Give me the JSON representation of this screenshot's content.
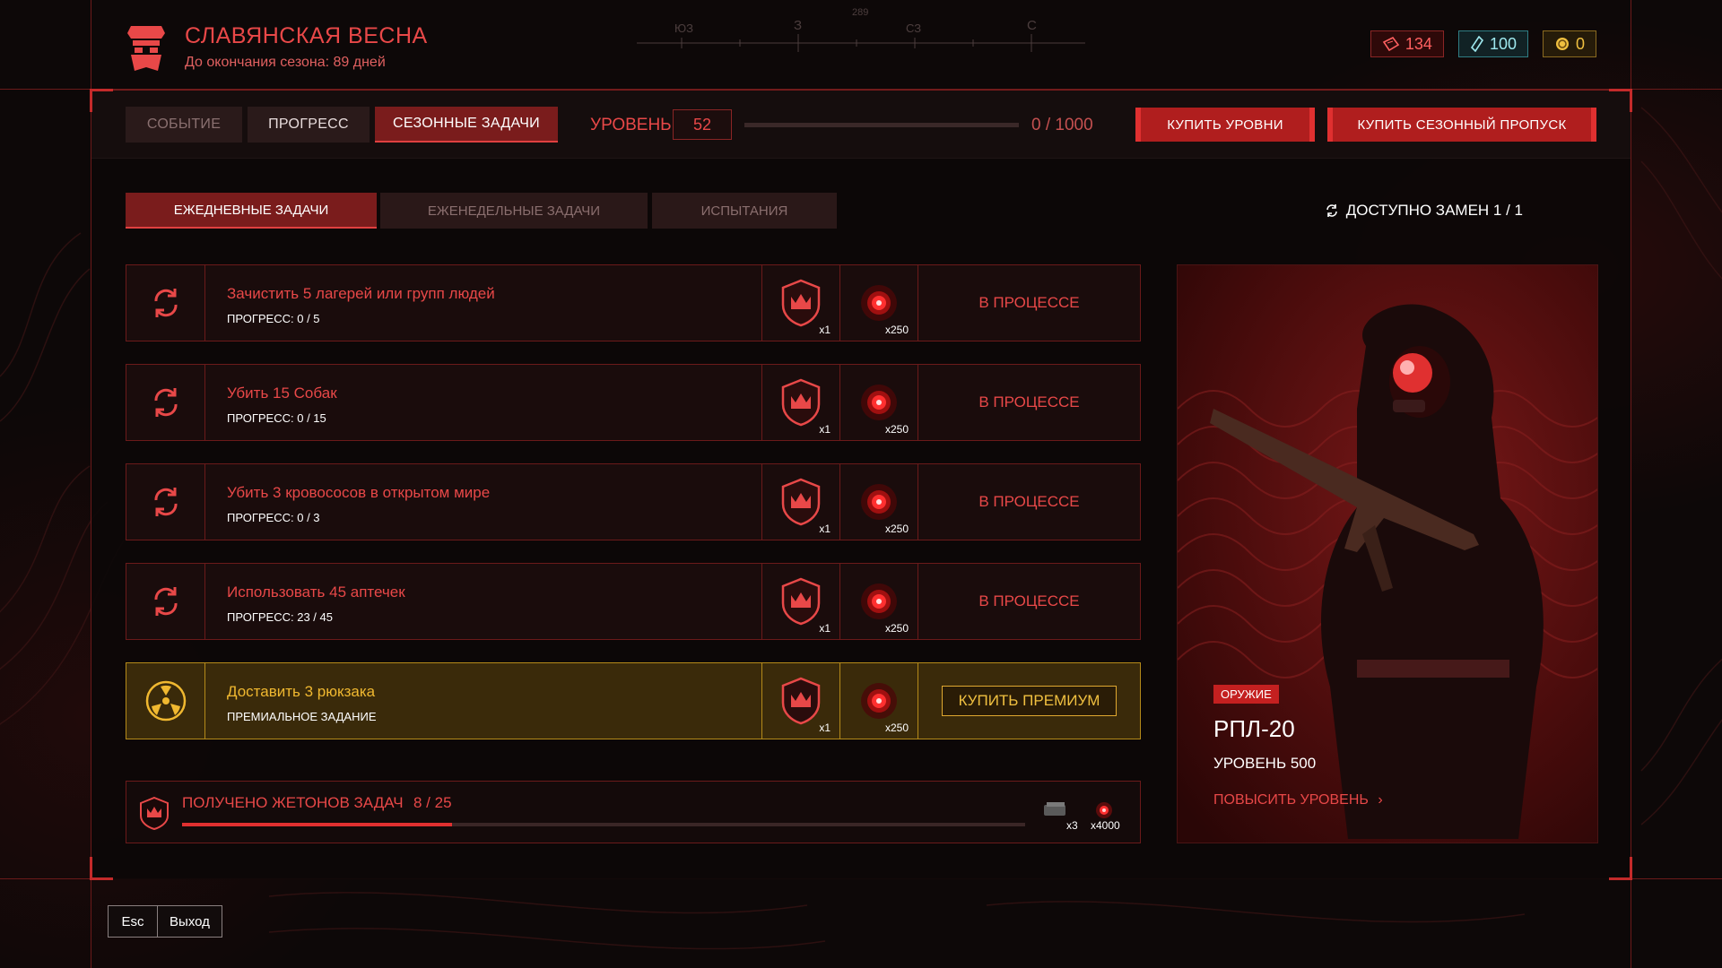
{
  "header": {
    "season_title": "СЛАВЯНСКАЯ ВЕСНА",
    "season_subtitle": "До окончания сезона: 89 дней"
  },
  "compass": {
    "marks": [
      "ЮЗ",
      "З",
      "СЗ",
      "С"
    ],
    "heading": "289"
  },
  "currencies": [
    {
      "icon": "ticket-icon",
      "value": "134",
      "color": "#ff6060"
    },
    {
      "icon": "crystal-icon",
      "value": "100",
      "color": "#9ee8ee"
    },
    {
      "icon": "coin-icon",
      "value": "0",
      "color": "#f0c040"
    }
  ],
  "topbar": {
    "tabs": [
      {
        "label": "СОБЫТИЕ",
        "state": "inactive"
      },
      {
        "label": "ПРОГРЕСС",
        "state": "mid"
      },
      {
        "label": "СЕЗОННЫЕ ЗАДАЧИ",
        "state": "active"
      }
    ],
    "level_label": "УРОВЕНЬ",
    "level_value": "52",
    "xp_text": "0 / 1000",
    "xp_fraction": 0,
    "buy_levels_label": "КУПИТЬ УРОВНИ",
    "buy_pass_label": "КУПИТЬ СЕЗОННЫЙ ПРОПУСК"
  },
  "subtabs": [
    {
      "label": "ЕЖЕДНЕВНЫЕ ЗАДАЧИ",
      "state": "active"
    },
    {
      "label": "ЕЖЕНЕДЕЛЬНЫЕ ЗАДАЧИ",
      "state": "inactive"
    },
    {
      "label": "ИСПЫТАНИЯ",
      "state": "inactive"
    }
  ],
  "swap_info": "ДОСТУПНО ЗАМЕН 1 / 1",
  "tasks": [
    {
      "title": "Зачистить 5 лагерей или групп людей",
      "progress": "ПРОГРЕСС: 0 / 5",
      "reward1_qty": "x1",
      "reward2_qty": "x250",
      "status": "В ПРОЦЕССЕ",
      "premium": false
    },
    {
      "title": "Убить 15 Собак",
      "progress": "ПРОГРЕСС: 0 / 15",
      "reward1_qty": "x1",
      "reward2_qty": "x250",
      "status": "В ПРОЦЕССЕ",
      "premium": false
    },
    {
      "title": "Убить 3 кровососов в открытом мире",
      "progress": "ПРОГРЕСС: 0 / 3",
      "reward1_qty": "x1",
      "reward2_qty": "x250",
      "status": "В ПРОЦЕССЕ",
      "premium": false
    },
    {
      "title": "Использовать 45 аптечек",
      "progress": "ПРОГРЕСС: 23 / 45",
      "reward1_qty": "x1",
      "reward2_qty": "x250",
      "status": "В ПРОЦЕССЕ",
      "premium": false
    },
    {
      "title": "Доставить 3 рюкзака",
      "progress": "ПРЕМИАЛЬНОЕ ЗАДАНИЕ",
      "reward1_qty": "x1",
      "reward2_qty": "x250",
      "status": "КУПИТЬ ПРЕМИУМ",
      "premium": true
    }
  ],
  "tokens": {
    "title": "ПОЛУЧЕНО ЖЕТОНОВ ЗАДАЧ",
    "count": "8 / 25",
    "fraction": 0.32,
    "reward1_qty": "x3",
    "reward2_qty": "x4000"
  },
  "card": {
    "tag": "ОРУЖИЕ",
    "name": "РПЛ-20",
    "level": "УРОВЕНЬ 500",
    "link": "ПОВЫСИТЬ УРОВЕНЬ"
  },
  "footer": {
    "key": "Esc",
    "action": "Выход"
  }
}
